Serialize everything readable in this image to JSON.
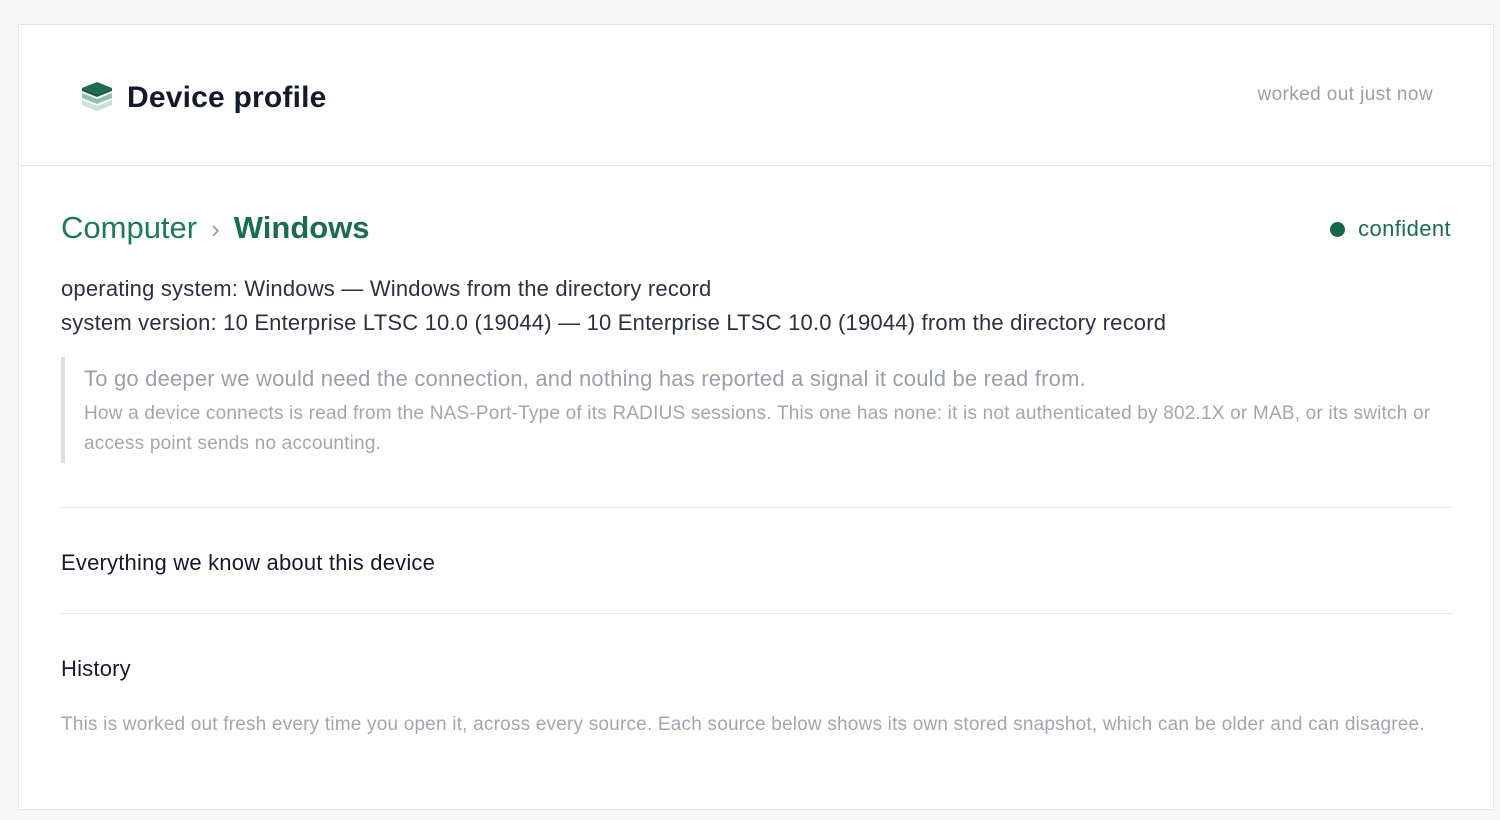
{
  "header": {
    "title": "Device profile",
    "computed_at": "worked out just now",
    "icon": "layers-icon"
  },
  "classification": {
    "category": "Computer",
    "separator": "›",
    "os": "Windows",
    "confidence": "confident",
    "confidence_color": "#17684a"
  },
  "facts": [
    "operating system: Windows — Windows from the directory record",
    "system version: 10 Enterprise LTSC 10.0 (19044) — 10 Enterprise LTSC 10.0 (19044) from the directory record"
  ],
  "connection_note": {
    "headline": "To go deeper we would need the connection, and nothing has reported a signal it could be read from.",
    "detail": "How a device connects is read from the NAS-Port-Type of its RADIUS sessions. This one has none: it is not authenticated by 802.1X or MAB, or its switch or access point sends no accounting."
  },
  "sections": {
    "everything": "Everything we know about this device",
    "history": "History",
    "history_note": "This is worked out fresh every time you open it, across every source. Each source below shows its own stored snapshot, which can be older and can disagree."
  },
  "colors": {
    "accent": "#1b6b4f",
    "icon_dark": "#1d6b52",
    "icon_light": "#b9d8c8"
  }
}
